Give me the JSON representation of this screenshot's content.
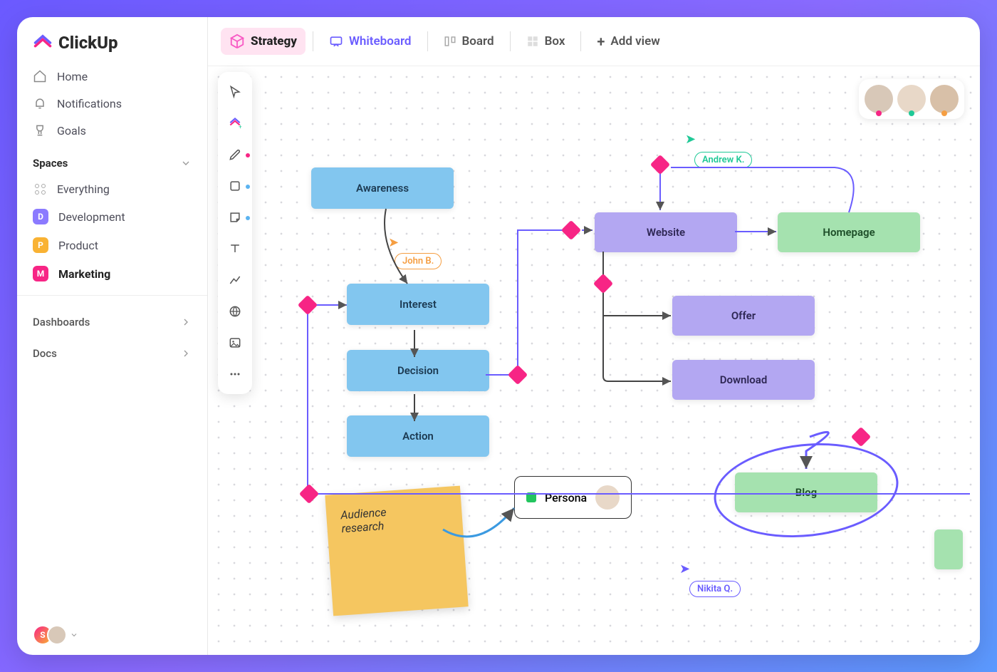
{
  "brand": "ClickUp",
  "nav": {
    "home": "Home",
    "notifications": "Notifications",
    "goals": "Goals"
  },
  "spaces": {
    "heading": "Spaces",
    "everything": "Everything",
    "items": [
      {
        "letter": "D",
        "label": "Development",
        "color": "#8b7aff"
      },
      {
        "letter": "P",
        "label": "Product",
        "color": "#f9b233"
      },
      {
        "letter": "M",
        "label": "Marketing",
        "color": "#f72585"
      }
    ]
  },
  "sections": {
    "dashboards": "Dashboards",
    "docs": "Docs"
  },
  "tabs": {
    "strategy": "Strategy",
    "whiteboard": "Whiteboard",
    "board": "Board",
    "box": "Box",
    "add_view": "Add view"
  },
  "whiteboard": {
    "nodes": {
      "awareness": "Awareness",
      "interest": "Interest",
      "decision": "Decision",
      "action": "Action",
      "website": "Website",
      "homepage": "Homepage",
      "offer": "Offer",
      "download": "Download",
      "blog": "Blog",
      "persona": "Persona"
    },
    "sticky": {
      "line1": "Audience",
      "line2": "research"
    },
    "cursors": {
      "john": "John B.",
      "andrew": "Andrew K.",
      "nikita": "Nikita Q."
    }
  },
  "colors": {
    "blue_node": "#82c6ef",
    "purple_node": "#b3a7f2",
    "green_node": "#a5e2af",
    "pink": "#f72585",
    "teal": "#20c997",
    "orange": "#f59e42",
    "indigo": "#6a5cff"
  },
  "collab_dots": [
    "#f72585",
    "#20c997",
    "#f59e42"
  ]
}
